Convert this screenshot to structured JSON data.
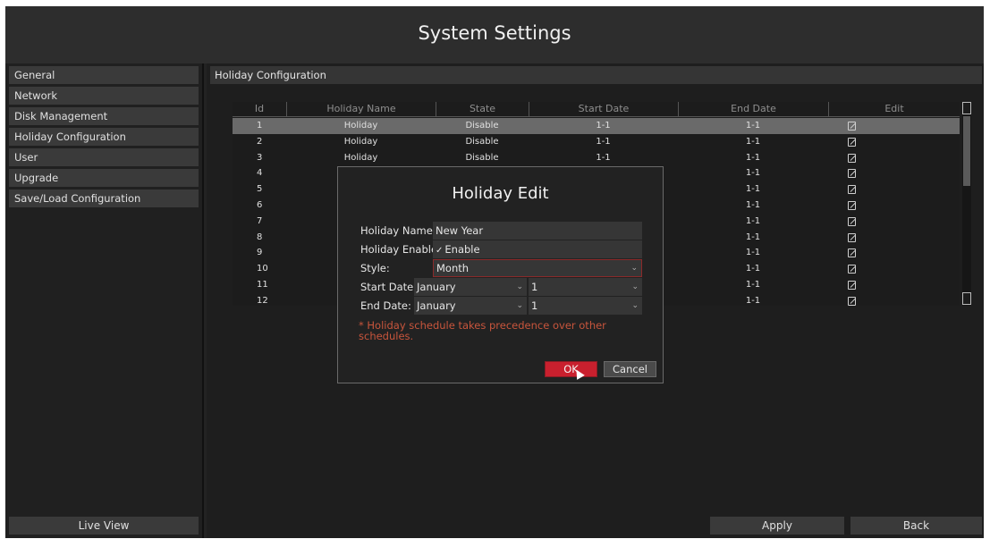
{
  "window": {
    "title": "System Settings"
  },
  "sidebar": {
    "items": [
      {
        "label": "General"
      },
      {
        "label": "Network"
      },
      {
        "label": "Disk Management"
      },
      {
        "label": "Holiday Configuration"
      },
      {
        "label": "User"
      },
      {
        "label": "Upgrade"
      },
      {
        "label": "Save/Load Configuration"
      }
    ],
    "live_view_label": "Live View"
  },
  "main": {
    "section_title": "Holiday Configuration",
    "columns": [
      "Id",
      "Holiday Name",
      "State",
      "Start Date",
      "End Date",
      "Edit"
    ],
    "rows": [
      {
        "id": "1",
        "name": "Holiday",
        "state": "Disable",
        "start": "1-1",
        "end": "1-1"
      },
      {
        "id": "2",
        "name": "Holiday",
        "state": "Disable",
        "start": "1-1",
        "end": "1-1"
      },
      {
        "id": "3",
        "name": "Holiday",
        "state": "Disable",
        "start": "1-1",
        "end": "1-1"
      },
      {
        "id": "4",
        "name": "",
        "state": "",
        "start": "",
        "end": "1-1"
      },
      {
        "id": "5",
        "name": "",
        "state": "",
        "start": "",
        "end": "1-1"
      },
      {
        "id": "6",
        "name": "",
        "state": "",
        "start": "",
        "end": "1-1"
      },
      {
        "id": "7",
        "name": "",
        "state": "",
        "start": "",
        "end": "1-1"
      },
      {
        "id": "8",
        "name": "",
        "state": "",
        "start": "",
        "end": "1-1"
      },
      {
        "id": "9",
        "name": "",
        "state": "",
        "start": "",
        "end": "1-1"
      },
      {
        "id": "10",
        "name": "",
        "state": "",
        "start": "",
        "end": "1-1"
      },
      {
        "id": "11",
        "name": "",
        "state": "",
        "start": "",
        "end": "1-1"
      },
      {
        "id": "12",
        "name": "",
        "state": "",
        "start": "",
        "end": "1-1"
      }
    ],
    "edit_icon": "edit-icon",
    "apply_label": "Apply",
    "back_label": "Back"
  },
  "dialog": {
    "title": "Holiday Edit",
    "holiday_name_label": "Holiday Name",
    "holiday_name_value": "New Year",
    "holiday_enable_label": "Holiday Enable",
    "holiday_enable_check": "✓",
    "holiday_enable_value": "Enable",
    "style_label": "Style:",
    "style_value": "Month",
    "start_date_label": "Start Date:",
    "start_month": "January",
    "start_day": "1",
    "end_date_label": "End Date:",
    "end_month": "January",
    "end_day": "1",
    "caret": "⌄",
    "note": "* Holiday schedule takes precedence over other schedules.",
    "ok_label": "OK",
    "cancel_label": "Cancel"
  },
  "colors": {
    "accent_red": "#c9202e",
    "note_orange": "#c8553c",
    "selected_row": "#6a6a6a"
  }
}
